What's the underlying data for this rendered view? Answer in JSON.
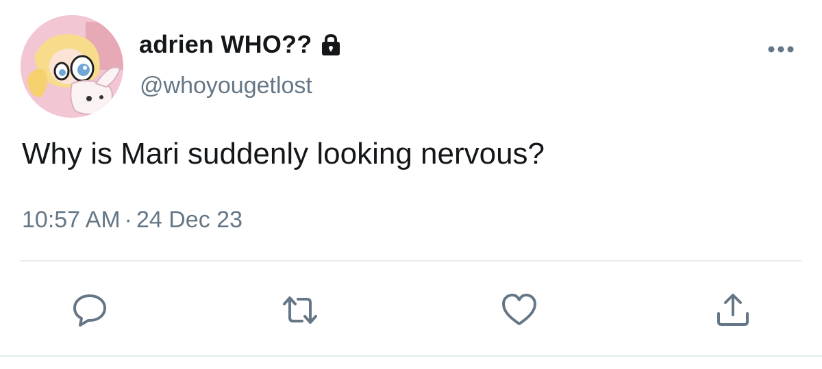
{
  "tweet": {
    "display_name": "adrien WHO??",
    "handle": "@whoyougetlost",
    "text": "Why is Mari suddenly looking nervous?",
    "time": "10:57 AM",
    "separator": "·",
    "date": "24 Dec 23"
  },
  "icons": {
    "avatar": "avatar-image",
    "lock": "lock-icon",
    "more": "more-icon",
    "reply": "reply-icon",
    "retweet": "retweet-icon",
    "like": "heart-icon",
    "share": "share-icon"
  },
  "colors": {
    "text": "#14171a",
    "secondary": "#657786",
    "icon": "#657786",
    "divider": "#e6ecf0"
  }
}
